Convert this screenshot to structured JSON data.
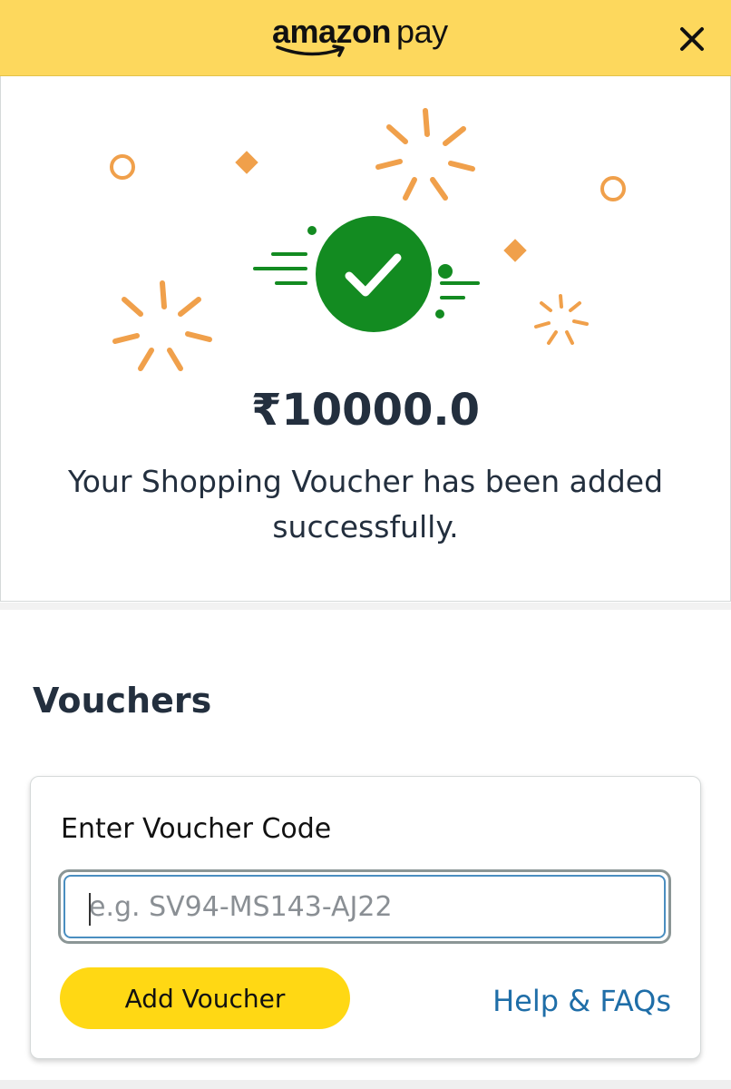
{
  "header": {
    "logo_brand": "amazon",
    "logo_product": "pay",
    "close_icon": "close-icon",
    "background_color": "#fdd85d"
  },
  "success": {
    "amount": "₹10000.0",
    "message": "Your Shopping Voucher has been added successfully.",
    "check_icon": "check-circle-icon",
    "accent_green": "#138b21",
    "confetti_color": "#f0a04b"
  },
  "vouchers": {
    "title": "Vouchers",
    "input_label": "Enter Voucher Code",
    "input_value": "",
    "input_placeholder": "e.g. SV94-MS143-AJ22",
    "add_button_label": "Add Voucher",
    "add_button_color": "#ffd814",
    "help_link": "Help & FAQs",
    "link_color": "#1f6ea8"
  }
}
